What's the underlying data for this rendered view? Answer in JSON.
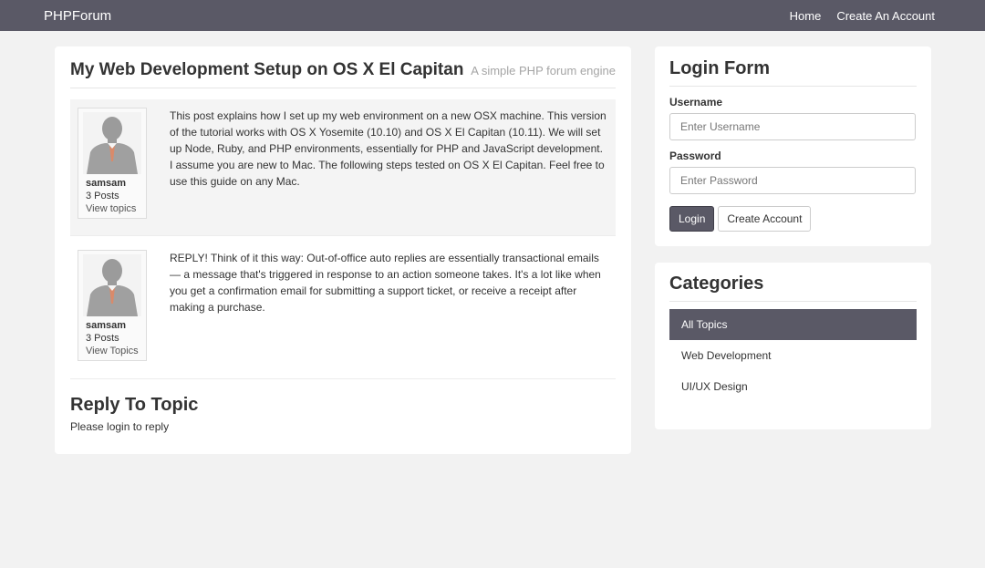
{
  "navbar": {
    "brand": "PHPForum",
    "links": [
      "Home",
      "Create An Account"
    ]
  },
  "topic": {
    "title": "My Web Development Setup on OS X El Capitan",
    "subtitle": "A simple PHP forum engine"
  },
  "posts": [
    {
      "username": "samsam",
      "posts": "3 Posts",
      "view_topics": "View topics",
      "body": "This post explains how I set up my web environment on a new OSX machine. This version of the tutorial works with OS X Yosemite (10.10) and OS X El Capitan (10.11). We will set up Node, Ruby, and PHP environments, essentially for PHP and JavaScript development. I assume you are new to Mac. The following steps tested on OS X El Capitan. Feel free to use this guide on any Mac."
    },
    {
      "username": "samsam",
      "posts": "3 Posts",
      "view_topics": "View Topics",
      "body": "REPLY! Think of it this way: Out-of-office auto replies are essentially transactional emails — a message that's triggered in response to an action someone takes. It's a lot like when you get a confirmation email for submitting a support ticket, or receive a receipt after making a purchase."
    }
  ],
  "reply": {
    "title": "Reply To Topic",
    "note": "Please login to reply"
  },
  "login": {
    "title": "Login Form",
    "username_label": "Username",
    "username_placeholder": "Enter Username",
    "password_label": "Password",
    "password_placeholder": "Enter Password",
    "login_button": "Login",
    "create_button": "Create Account"
  },
  "categories": {
    "title": "Categories",
    "items": [
      "All Topics",
      "Web Development",
      "UI/UX Design"
    ],
    "active": "All Topics"
  },
  "colors": {
    "navbar": "#5a5966",
    "background": "#f2f2f2",
    "active_category": "#5a5966"
  }
}
